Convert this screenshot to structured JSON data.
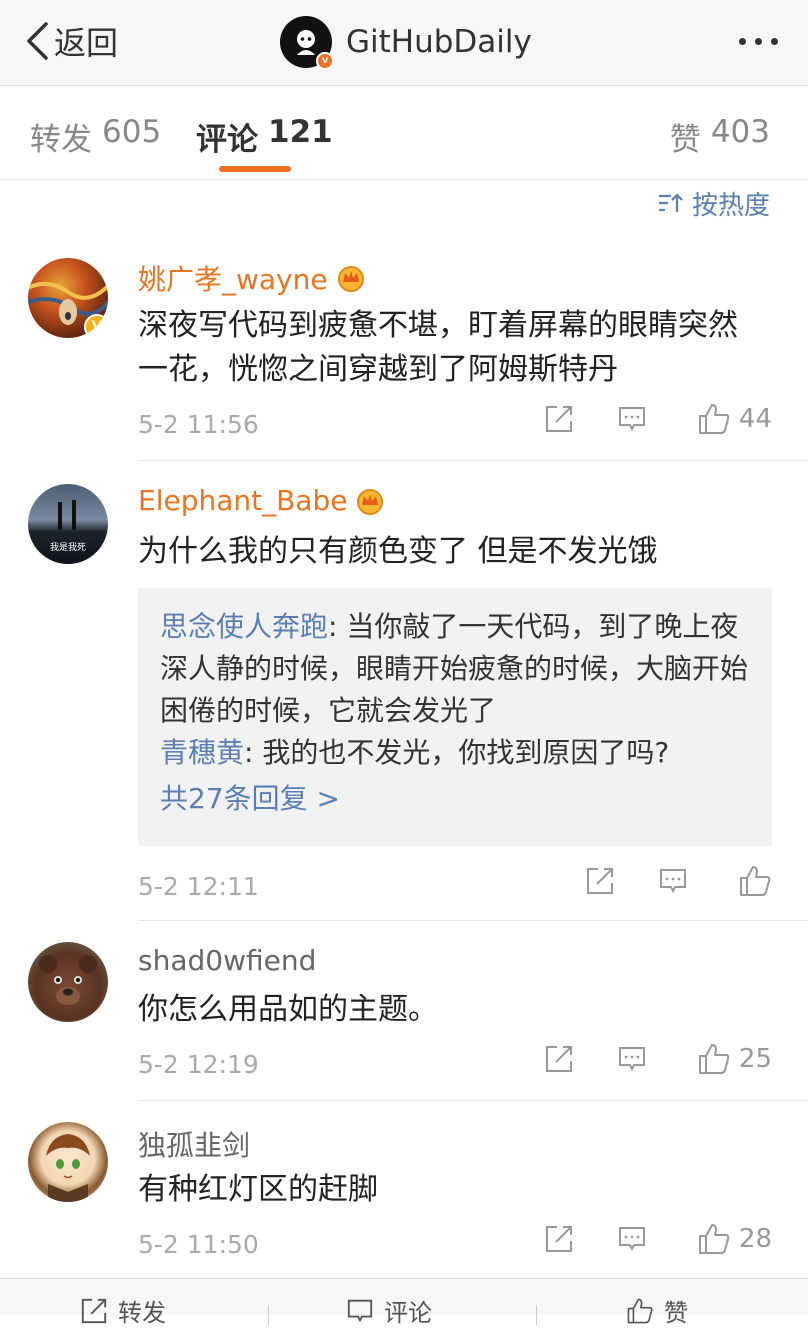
{
  "nav": {
    "back_label": "返回",
    "title": "GitHubDaily"
  },
  "tabs": {
    "repost_label": "转发",
    "repost_count": "605",
    "comment_label": "评论",
    "comment_count": "121",
    "like_label": "赞",
    "like_count": "403"
  },
  "sort": {
    "label": "按热度"
  },
  "comments": [
    {
      "user": "姚广孝_wayne",
      "vip": true,
      "verified": true,
      "text": "深夜写代码到疲惫不堪，盯着屏幕的眼睛突然一花，恍惚之间穿越到了阿姆斯特丹",
      "time": "5-2 11:56",
      "likes": "44"
    },
    {
      "user": "Elephant_Babe",
      "vip": true,
      "verified": false,
      "avatar_text": "我是我死",
      "text": "为什么我的只有颜色变了 但是不发光饿",
      "replies": [
        {
          "user": "思念使人奔跑",
          "text": ": 当你敲了一天代码，到了晚上夜深人静的时候，眼睛开始疲惫的时候，大脑开始困倦的时候，它就会发光了"
        },
        {
          "user": "青穗黄",
          "text": ": 我的也不发光，你找到原因了吗?"
        }
      ],
      "more_replies": "共27条回复 >",
      "time": "5-2 12:11",
      "likes": ""
    },
    {
      "user": "shad0wfiend",
      "vip": false,
      "text": "你怎么用品如的主题。",
      "time": "5-2 12:19",
      "likes": "25"
    },
    {
      "user": "独孤韭剑",
      "vip": false,
      "text": "有种红灯区的赶脚",
      "time": "5-2 11:50",
      "likes": "28"
    }
  ],
  "bottom": {
    "repost": "转发",
    "comment": "评论",
    "like": "赞"
  },
  "colors": {
    "accent": "#f36f21",
    "link": "#5b7fb3",
    "vip_name": "#e97522"
  },
  "icons": [
    "chevron-left-icon",
    "more-dots-icon",
    "sort-icon",
    "crown-icon",
    "share-icon",
    "comment-icon",
    "thumb-up-icon",
    "verified-badge-icon"
  ]
}
